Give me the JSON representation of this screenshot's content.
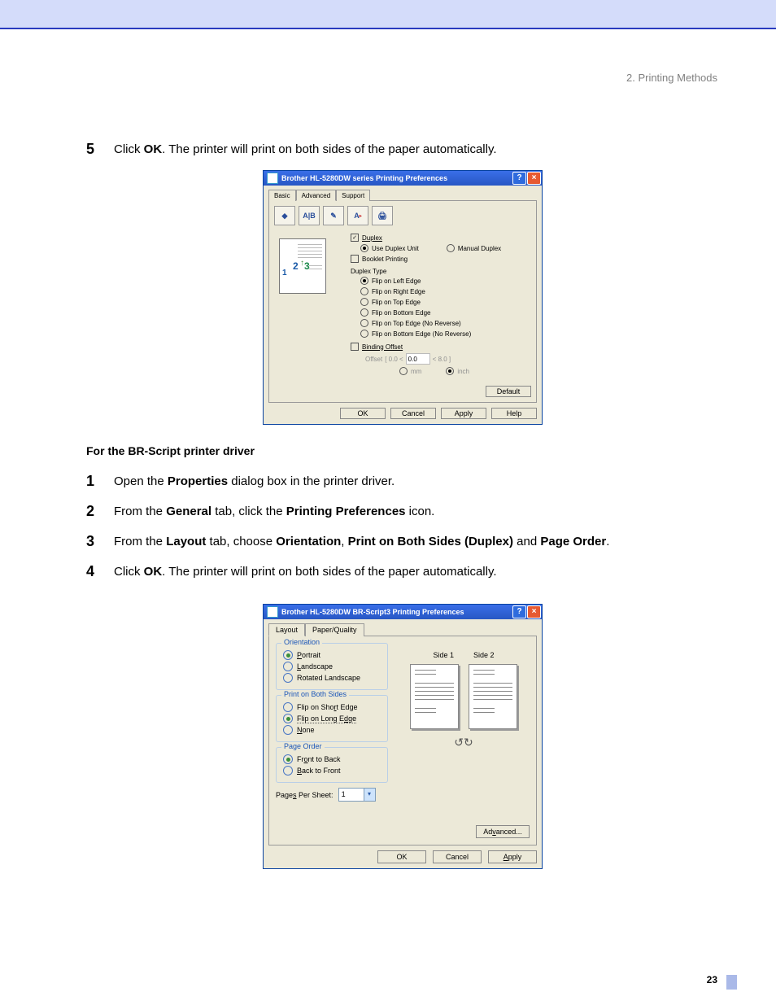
{
  "header": {
    "chapter": "2. Printing Methods"
  },
  "page_number": "23",
  "steps_a": [
    {
      "num": "5",
      "pre": "Click ",
      "bold": "OK",
      "post": ". The printer will print on both sides of the paper automatically."
    }
  ],
  "subheading": "For the BR-Script printer driver",
  "steps_b": [
    {
      "num": "1",
      "parts": [
        {
          "t": "Open the "
        },
        {
          "t": "Properties",
          "b": true
        },
        {
          "t": " dialog box in the printer driver."
        }
      ]
    },
    {
      "num": "2",
      "parts": [
        {
          "t": "From the "
        },
        {
          "t": "General",
          "b": true
        },
        {
          "t": " tab, click the "
        },
        {
          "t": "Printing Preferences",
          "b": true
        },
        {
          "t": " icon."
        }
      ]
    },
    {
      "num": "3",
      "parts": [
        {
          "t": "From the "
        },
        {
          "t": "Layout",
          "b": true
        },
        {
          "t": " tab, choose "
        },
        {
          "t": "Orientation",
          "b": true
        },
        {
          "t": ", "
        },
        {
          "t": "Print on Both Sides (Duplex)",
          "b": true
        },
        {
          "t": " and "
        },
        {
          "t": "Page Order",
          "b": true
        },
        {
          "t": "."
        }
      ]
    },
    {
      "num": "4",
      "parts": [
        {
          "t": "Click "
        },
        {
          "t": "OK",
          "b": true
        },
        {
          "t": ". The printer will print on both sides of the paper automatically."
        }
      ]
    }
  ],
  "dlg1": {
    "title": "Brother HL-5280DW series Printing Preferences",
    "tabs": [
      "Basic",
      "Advanced",
      "Support"
    ],
    "duplex_label": "Duplex",
    "use_duplex_unit": "Use Duplex Unit",
    "manual_duplex": "Manual Duplex",
    "booklet": "Booklet Printing",
    "duplex_type": "Duplex Type",
    "types": [
      "Flip on Left Edge",
      "Flip on Right Edge",
      "Flip on Top Edge",
      "Flip on Bottom Edge",
      "Flip on Top Edge (No Reverse)",
      "Flip on Bottom Edge (No Reverse)"
    ],
    "binding_offset": "Binding Offset",
    "offset_label": "Offset",
    "offset_lo": "[   0.0  <",
    "offset_val": "0.0",
    "offset_hi": "<   8.0      ]",
    "unit_mm": "mm",
    "unit_inch": "inch",
    "default_btn": "Default",
    "buttons": {
      "ok": "OK",
      "cancel": "Cancel",
      "apply": "Apply",
      "help": "Help"
    }
  },
  "dlg2": {
    "title": "Brother HL-5280DW BR-Script3 Printing Preferences",
    "tabs": [
      "Layout",
      "Paper/Quality"
    ],
    "orientation": {
      "title": "Orientation",
      "portrait": "Portrait",
      "landscape": "Landscape",
      "rotated": "Rotated Landscape"
    },
    "both_sides": {
      "title": "Print on Both Sides",
      "short": "Flip on Short Edge",
      "long": "Flip on Long Edge",
      "none": "None"
    },
    "page_order": {
      "title": "Page Order",
      "ftb": "Front to Back",
      "btf": "Back to Front"
    },
    "pps_label": "Pages Per Sheet:",
    "pps_value": "1",
    "side1": "Side 1",
    "side2": "Side 2",
    "advanced": "Advanced...",
    "buttons": {
      "ok": "OK",
      "cancel": "Cancel",
      "apply": "Apply"
    }
  }
}
